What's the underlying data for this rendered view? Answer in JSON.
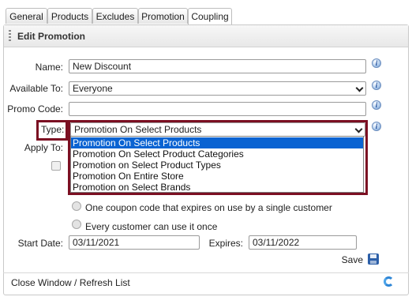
{
  "tabs": [
    {
      "label": "General"
    },
    {
      "label": "Products"
    },
    {
      "label": "Excludes"
    },
    {
      "label": "Promotion"
    },
    {
      "label": "Coupling"
    }
  ],
  "panel": {
    "title": "Edit Promotion"
  },
  "form": {
    "name_label": "Name:",
    "name_value": "New Discount",
    "available_label": "Available To:",
    "available_value": "Everyone",
    "promo_label": "Promo Code:",
    "promo_value": "",
    "type_label": "Type:",
    "type_value": "Promotion On Select Products",
    "apply_label": "Apply To:",
    "type_options": [
      "Promotion On Select Products",
      "Promotion On Select Product Categories",
      "Promotion on Select Product Types",
      "Promotion On Entire Store",
      "Promotion on Select Brands"
    ],
    "coupon_option_1": "One coupon code that expires on use by a single customer",
    "coupon_option_2": "Every customer can use it once",
    "start_label": "Start Date:",
    "start_value": "03/11/2021",
    "expires_label": "Expires:",
    "expires_value": "03/11/2022",
    "save_label": "Save"
  },
  "footer": {
    "link": "Close Window / Refresh List"
  },
  "colors": {
    "highlight": "#7b0f22",
    "selected_option": "#0a63d2"
  }
}
